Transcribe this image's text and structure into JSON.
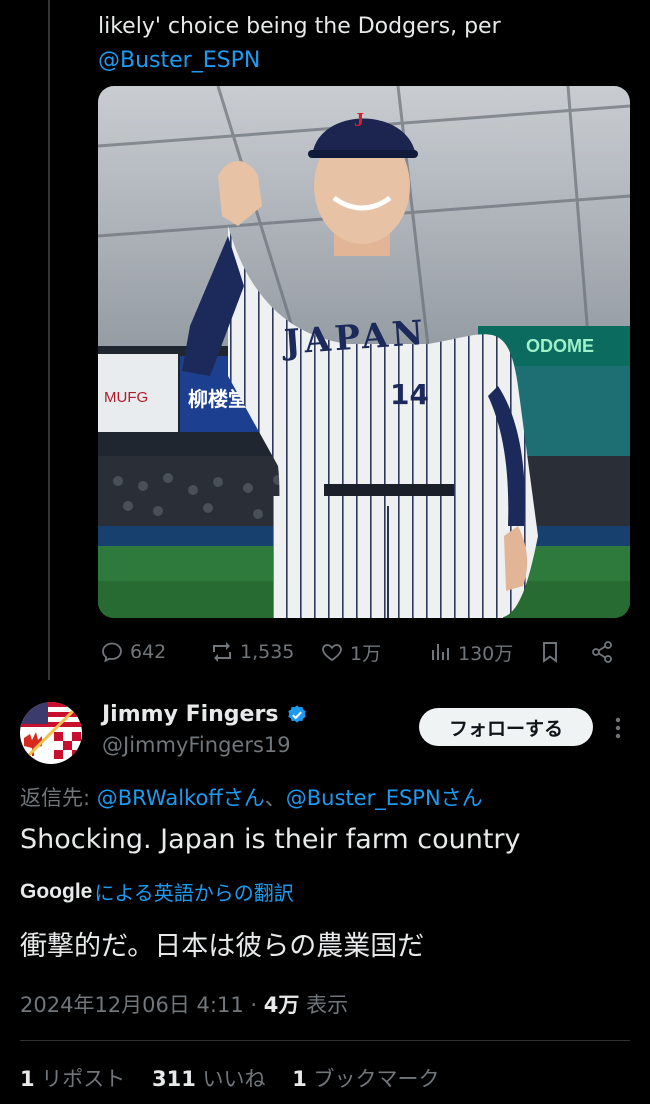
{
  "previous_tweet": {
    "text_line": "likely' choice being the Dodgers, per",
    "mention": "@Buster_ESPN",
    "photo": {
      "cap_letter": "J",
      "jersey_text": "JAPAN",
      "jersey_number": "14",
      "banner_text": "柳楼堂",
      "sign_left": "MUFG",
      "sign_right": "ODOME"
    },
    "actions": {
      "replies": "642",
      "reposts": "1,535",
      "likes": "1万",
      "views": "130万"
    }
  },
  "reply": {
    "name": "Jimmy Fingers",
    "handle": "@JimmyFingers19",
    "follow_label": "フォローする",
    "reply_to_prefix": "返信先: ",
    "reply_to_mention1": "@BRWalkoffさん",
    "reply_to_sep": "、",
    "reply_to_mention2": "@Buster_ESPNさん",
    "text": "Shocking. Japan is their farm country",
    "translate_brand": "Google",
    "translate_label": "による英語からの翻訳",
    "translated_text": "衝撃的だ。日本は彼らの農業国だ",
    "timestamp": "2024年12月06日 4:11",
    "separator": " · ",
    "views": "4万",
    "views_label": " 表示",
    "reposts_count": "1",
    "reposts_label": " リポスト",
    "likes_count": "311",
    "likes_label": " いいね",
    "bookmarks_count": "1",
    "bookmarks_label": " ブックマーク"
  },
  "colors": {
    "background": "#000000",
    "text": "#e7e9ea",
    "secondary": "#71767b",
    "link": "#1d9bf0",
    "verified": "#1d9bf0"
  }
}
